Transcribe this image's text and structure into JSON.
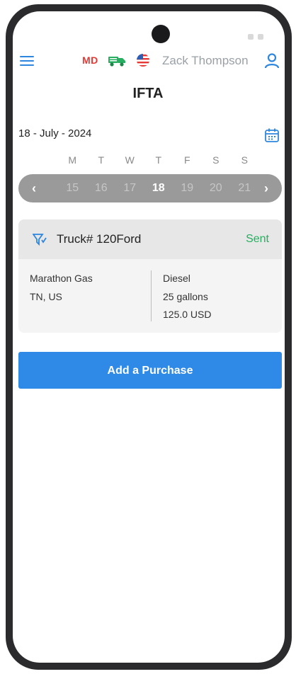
{
  "header": {
    "state_code": "MD",
    "user_name": "Zack Thompson"
  },
  "page": {
    "title": "IFTA"
  },
  "date_picker": {
    "date_label": "18 - July - 2024",
    "weekdays": [
      "M",
      "T",
      "W",
      "T",
      "F",
      "S",
      "S"
    ],
    "days": [
      "15",
      "16",
      "17",
      "18",
      "19",
      "20",
      "21"
    ],
    "selected_day": "18"
  },
  "purchase_card": {
    "truck": "Truck# 120Ford",
    "status": "Sent",
    "vendor": "Marathon Gas",
    "location": "TN, US",
    "fuel_type": "Diesel",
    "quantity": "25 gallons",
    "cost": "125.0 USD"
  },
  "actions": {
    "add_purchase": "Add a Purchase"
  },
  "colors": {
    "accent": "#2e8ae6",
    "state_code": "#e53935",
    "truck_icon": "#27ae60",
    "status_sent": "#27ae60",
    "week_strip": "#9a9a9a"
  },
  "icons": [
    "menu-icon",
    "truck-icon",
    "flag-icon",
    "user-icon",
    "calendar-icon",
    "chevron-left-icon",
    "chevron-right-icon",
    "funnel-icon"
  ]
}
